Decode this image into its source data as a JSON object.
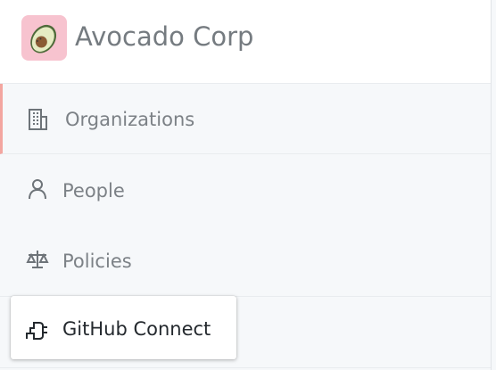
{
  "header": {
    "org_name": "Avocado Corp",
    "logo_icon": "avocado-logo-icon",
    "logo_bg": "#f7c3cf"
  },
  "nav": {
    "items": [
      {
        "label": "Organizations",
        "icon": "building-icon",
        "selected": true
      },
      {
        "label": "People",
        "icon": "person-icon",
        "selected": false
      },
      {
        "label": "Policies",
        "icon": "law-scale-icon",
        "selected": false
      },
      {
        "label": "GitHub Connect",
        "icon": "plug-icon",
        "selected": false
      }
    ]
  },
  "colors": {
    "selected_indicator": "#f3a6a0",
    "muted_text": "#7c8186",
    "active_text": "#24292e"
  }
}
